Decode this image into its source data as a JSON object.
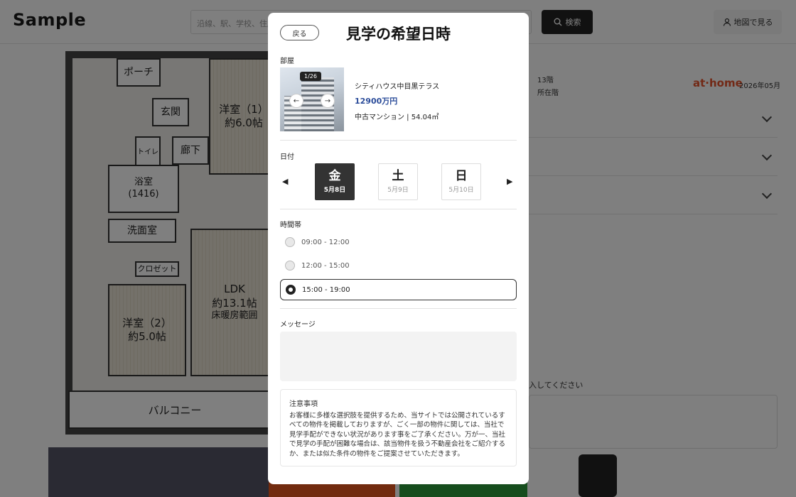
{
  "header": {
    "logo": "Sample",
    "search_placeholder": "沿線、駅、学校、住所",
    "search_button": "検索",
    "map_button": "地図で見る"
  },
  "background": {
    "floorplan_rooms": {
      "porch": "ポーチ",
      "entrance": "玄関",
      "western1": "洋室（1）",
      "western1_size": "約6.0帖",
      "toilet": "トイレ",
      "hallway": "廊下",
      "bath": "浴室",
      "bath_size": "(1416)",
      "washroom": "洗面室",
      "closet": "クロゼット",
      "western2": "洋室（2）",
      "western2_size": "約5.0帖",
      "ldk": "LDK",
      "ldk_size": "約13.1帖",
      "floor_heating": "床暖房範囲",
      "balcony": "バルコニー"
    },
    "floor_label": "13階",
    "location_label": "所在階",
    "brand": "at·home",
    "date": "2026年05月",
    "input_hint": "入してください"
  },
  "modal": {
    "back_label": "戻る",
    "title": "見学の希望日時",
    "room_section_label": "部屋",
    "photo_counter": "1/26",
    "property": {
      "name": "シティハウス中目黒テラス",
      "price": "12900万円",
      "description": "中古マンション | 54.04㎡"
    },
    "date_section_label": "日付",
    "days": [
      {
        "dow": "金",
        "date": "5月8日",
        "active": true
      },
      {
        "dow": "土",
        "date": "5月9日",
        "active": false
      },
      {
        "dow": "日",
        "date": "5月10日",
        "active": false
      }
    ],
    "time_section_label": "時間帯",
    "slots": [
      {
        "label": "09:00 - 12:00",
        "selected": false
      },
      {
        "label": "12:00 - 15:00",
        "selected": false
      },
      {
        "label": "15:00 - 19:00",
        "selected": true
      }
    ],
    "message_section_label": "メッセージ",
    "message_value": "",
    "notice": {
      "title": "注意事項",
      "body": "お客様に多様な選択肢を提供するため、当サイトでは公開されているすべての物件を掲載しておりますが、ごく一部の物件に関しては、当社で見学手配ができない状況があります事をご了承ください。万が一、当社で見学の手配が困難な場合は、該当物件を扱う不動産会社をご紹介するか、または似た条件の物件をご提案させていただきます。"
    }
  },
  "colors": {
    "price": "#2b4c9a",
    "active_day": "#333333",
    "overlay": "rgba(0,0,0,0.5)"
  }
}
